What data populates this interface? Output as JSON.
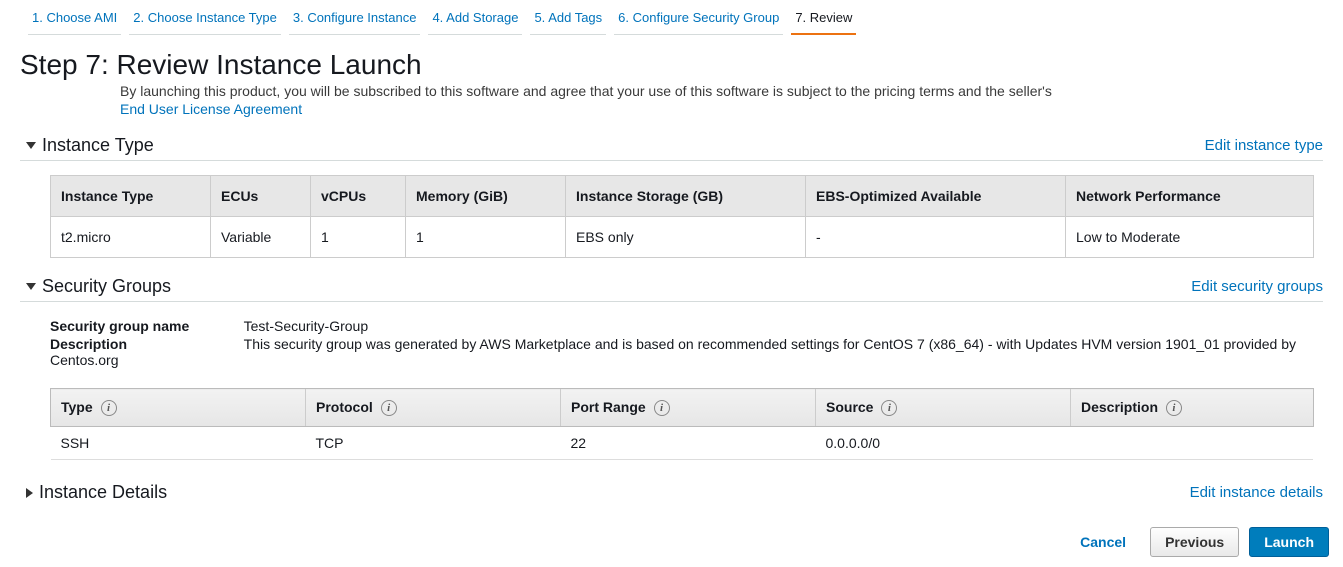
{
  "wizard": {
    "steps": [
      "1. Choose AMI",
      "2. Choose Instance Type",
      "3. Configure Instance",
      "4. Add Storage",
      "5. Add Tags",
      "6. Configure Security Group",
      "7. Review"
    ]
  },
  "page": {
    "title": "Step 7: Review Instance Launch",
    "intro": "By launching this product, you will be subscribed to this software and agree that your use of this software is subject to the pricing terms and the seller's",
    "eula": "End User License Agreement"
  },
  "instance_type": {
    "heading": "Instance Type",
    "edit": "Edit instance type",
    "headers": [
      "Instance Type",
      "ECUs",
      "vCPUs",
      "Memory (GiB)",
      "Instance Storage (GB)",
      "EBS-Optimized Available",
      "Network Performance"
    ],
    "row": [
      "t2.micro",
      "Variable",
      "1",
      "1",
      "EBS only",
      "-",
      "Low to Moderate"
    ]
  },
  "security_groups": {
    "heading": "Security Groups",
    "edit": "Edit security groups",
    "name_label": "Security group name",
    "name_value": "Test-Security-Group",
    "desc_label": "Description",
    "desc_value": "This security group was generated by AWS Marketplace and is based on recommended settings for CentOS 7 (x86_64) - with Updates HVM version 1901_01 provided by Centos.org",
    "headers": [
      "Type",
      "Protocol",
      "Port Range",
      "Source",
      "Description"
    ],
    "row": [
      "SSH",
      "TCP",
      "22",
      "0.0.0.0/0",
      ""
    ]
  },
  "instance_details": {
    "heading": "Instance Details",
    "edit": "Edit instance details"
  },
  "footer": {
    "cancel": "Cancel",
    "previous": "Previous",
    "launch": "Launch"
  }
}
